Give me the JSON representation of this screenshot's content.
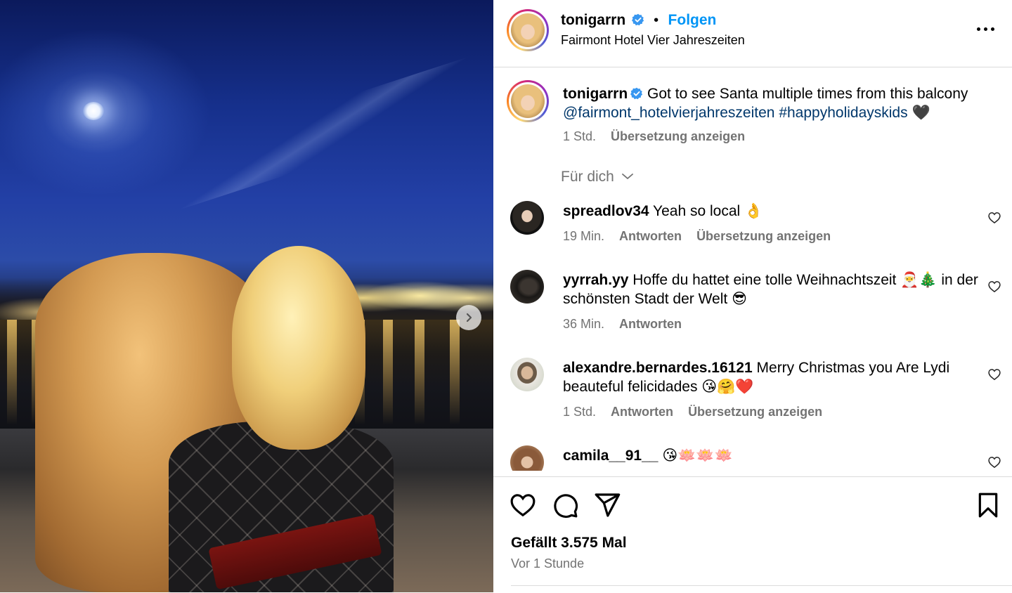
{
  "post": {
    "username": "tonigarrn",
    "follow_label": "Folgen",
    "location": "Fairmont Hotel Vier Jahreszeiten",
    "separator": "•"
  },
  "caption": {
    "username": "tonigarrn",
    "text": "Got to see Santa multiple times from this balcony",
    "mention": "@fairmont_hotelvierjahreszeiten",
    "hashtag": "#happyholidayskids",
    "emoji": "🖤",
    "time": "1 Std.",
    "translate": "Übersetzung anzeigen"
  },
  "for_you": {
    "label": "Für dich"
  },
  "comments": [
    {
      "username": "spreadlov34",
      "text": "Yeah so local 👌",
      "time": "19 Min.",
      "reply": "Antworten",
      "translate": "Übersetzung anzeigen"
    },
    {
      "username": "yyrrah.yy",
      "text": "Hoffe du hattet eine tolle Weihnachtszeit 🎅🎄 in der schönsten Stadt der Welt 😎",
      "time": "36 Min.",
      "reply": "Antworten"
    },
    {
      "username": "alexandre.bernardes.16121",
      "text": "Merry Christmas you Are Lydi beauteful felicidades 😘🤗❤️",
      "time": "1 Std.",
      "reply": "Antworten",
      "translate": "Übersetzung anzeigen"
    },
    {
      "username": "camila__91__",
      "text": "😘🪷🪷🪷"
    }
  ],
  "footer": {
    "likes": "Gefällt 3.575 Mal",
    "posted": "Vor 1 Stunde"
  },
  "colors": {
    "link_blue": "#0095f6",
    "mention_blue": "#00376b",
    "muted": "#737373",
    "divider": "#dbdbdb"
  },
  "icons": [
    "verified-icon",
    "more-icon",
    "chevron-down-icon",
    "heart-icon",
    "comment-icon",
    "share-icon",
    "bookmark-icon",
    "next-arrow-icon"
  ]
}
